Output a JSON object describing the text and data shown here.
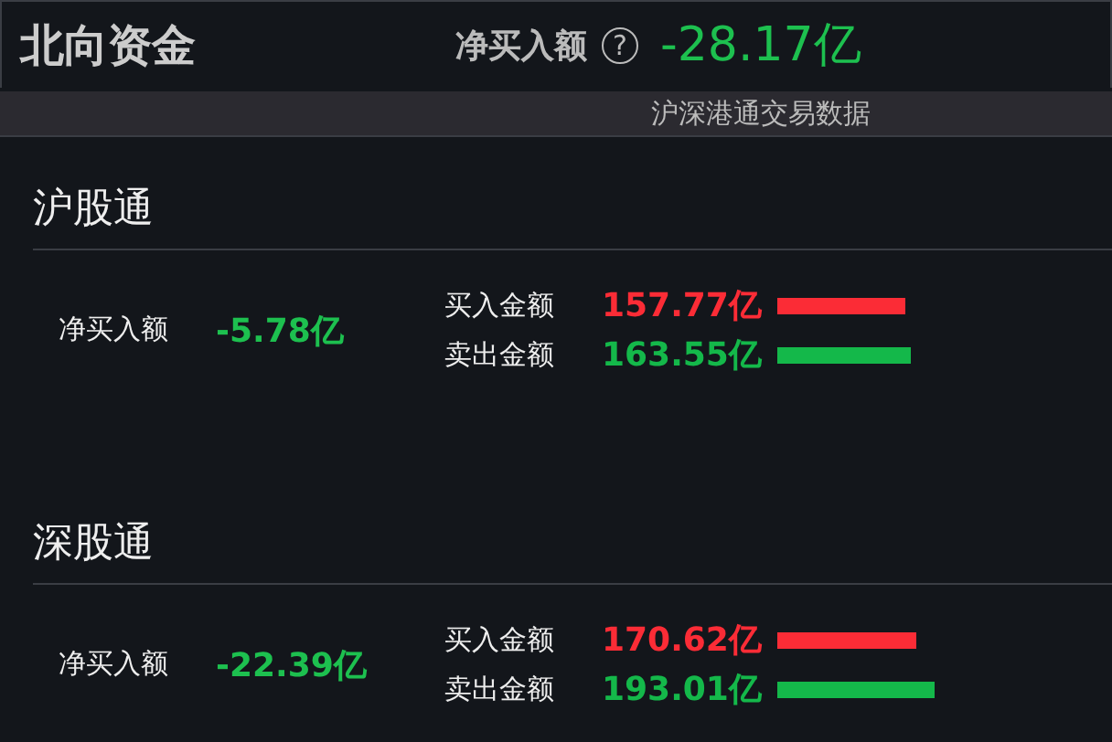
{
  "header": {
    "title": "北向资金",
    "net_label": "净买入额",
    "help_icon": "?",
    "net_value": "-28.17亿"
  },
  "subbar": {
    "text": "沪深港通交易数据"
  },
  "sections": [
    {
      "title": "沪股通",
      "net_label": "净买入额",
      "net_value": "-5.78亿",
      "flows": [
        {
          "kind": "buy",
          "label": "买入金额",
          "value": "157.77亿"
        },
        {
          "kind": "sell",
          "label": "卖出金额",
          "value": "163.55亿"
        }
      ]
    },
    {
      "title": "深股通",
      "net_label": "净买入额",
      "net_value": "-22.39亿",
      "flows": [
        {
          "kind": "buy",
          "label": "买入金额",
          "value": "170.62亿"
        },
        {
          "kind": "sell",
          "label": "卖出金额",
          "value": "193.01亿"
        }
      ]
    }
  ]
}
